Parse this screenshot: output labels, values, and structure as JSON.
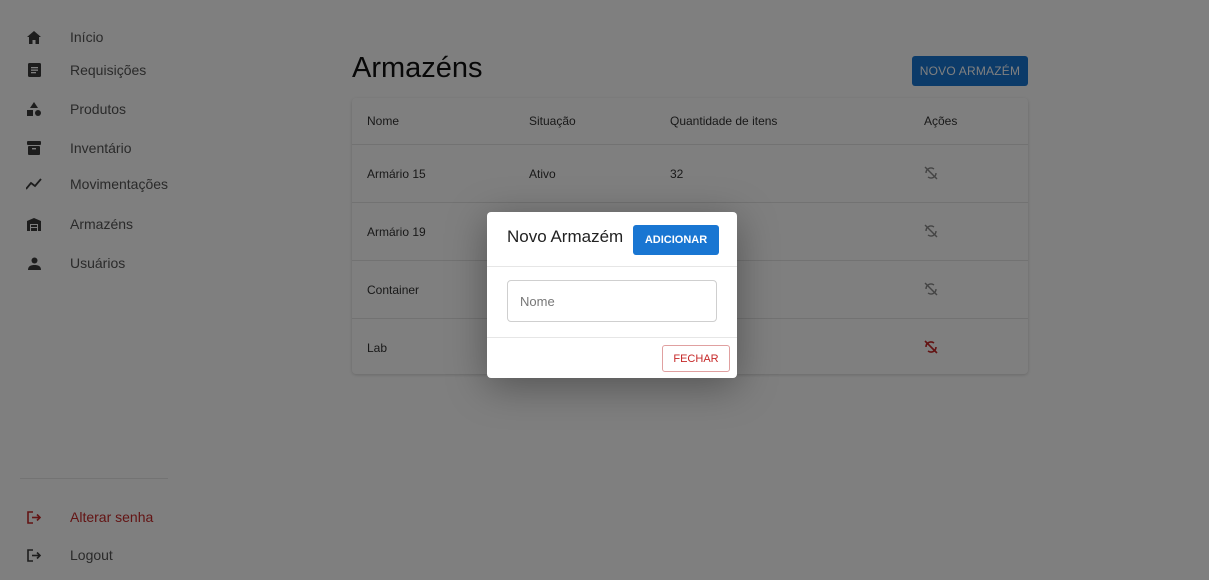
{
  "sidebar": {
    "items": [
      {
        "label": "Início",
        "icon": "home-icon"
      },
      {
        "label": "Requisições",
        "icon": "document-icon"
      },
      {
        "label": "Produtos",
        "icon": "shapes-icon"
      },
      {
        "label": "Inventário",
        "icon": "archive-icon"
      },
      {
        "label": "Movimentações",
        "icon": "trend-icon"
      },
      {
        "label": "Armazéns",
        "icon": "warehouse-icon"
      },
      {
        "label": "Usuários",
        "icon": "user-icon"
      }
    ],
    "bottom": [
      {
        "label": "Alterar senha",
        "icon": "logout-icon"
      },
      {
        "label": "Logout",
        "icon": "logout-icon"
      }
    ]
  },
  "page": {
    "title": "Armazéns",
    "new_button": "NOVO ARMAZÉM"
  },
  "table": {
    "columns": [
      "Nome",
      "Situação",
      "Quantidade de itens",
      "Ações"
    ],
    "rows": [
      {
        "name": "Armário 15",
        "status": "Ativo",
        "qty": "32"
      },
      {
        "name": "Armário 19",
        "status": "",
        "qty": ""
      },
      {
        "name": "Container",
        "status": "",
        "qty": ""
      },
      {
        "name": "Lab",
        "status": "",
        "qty": ""
      }
    ]
  },
  "modal": {
    "title": "Novo Armazém",
    "add_button": "ADICIONAR",
    "name_placeholder": "Nome",
    "close_button": "FECHAR"
  },
  "colors": {
    "primary": "#1976d2",
    "danger": "#c62828"
  }
}
